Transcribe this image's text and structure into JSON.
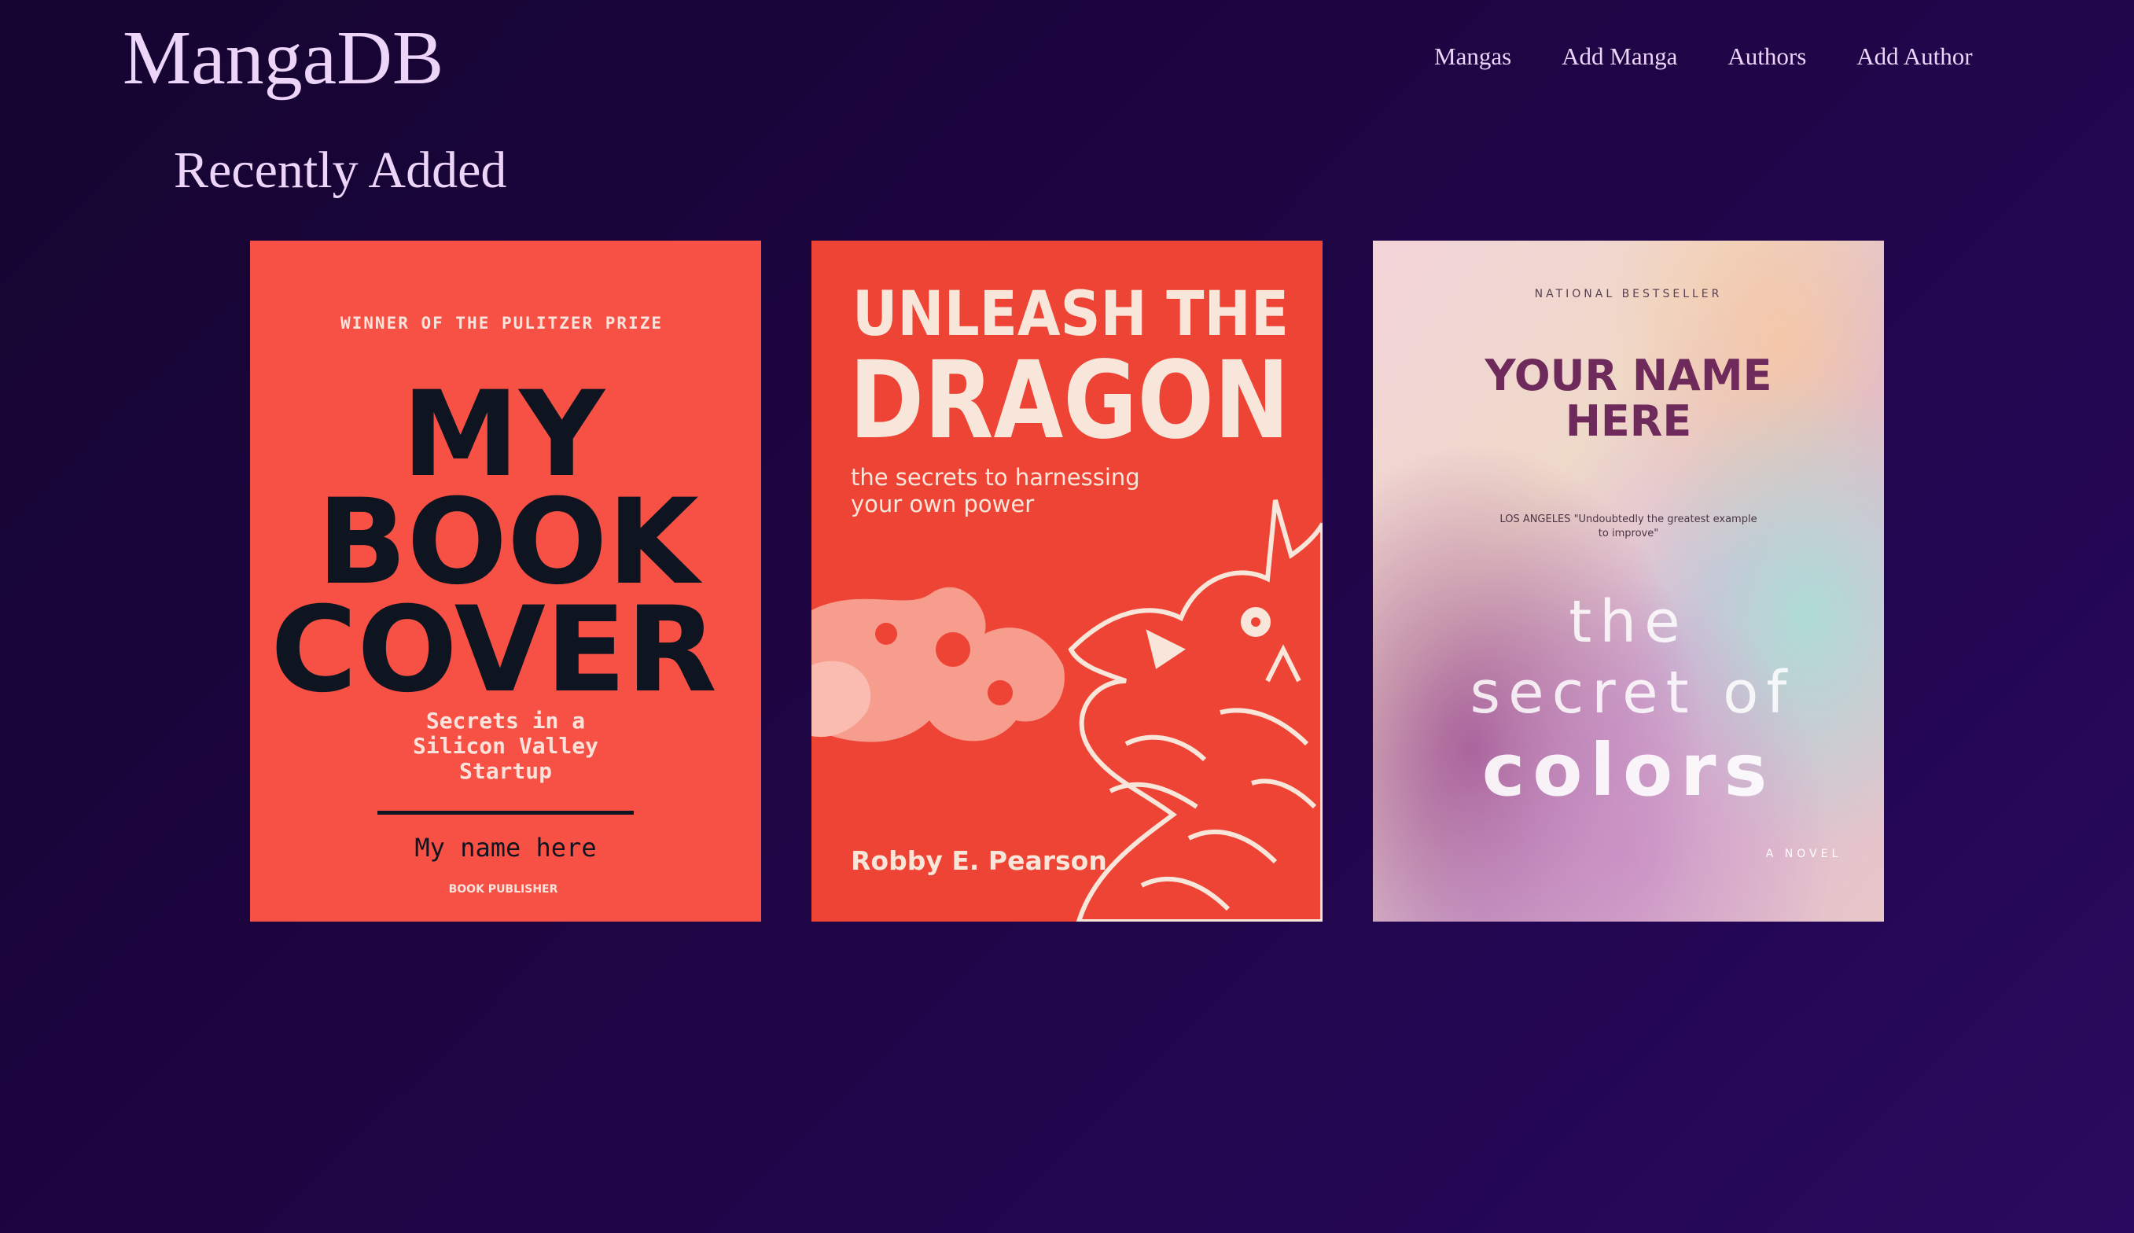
{
  "app": {
    "logo": "MangaDB"
  },
  "nav": {
    "items": [
      {
        "label": "Mangas"
      },
      {
        "label": "Add Manga"
      },
      {
        "label": "Authors"
      },
      {
        "label": "Add Author"
      }
    ]
  },
  "main": {
    "section_title": "Recently Added",
    "covers": [
      {
        "prize": "WINNER OF THE PULITZER PRIZE",
        "title_line1": "MY",
        "title_line2": "BOOK",
        "title_line3": "COVER",
        "subtitle_line1": "Secrets in a",
        "subtitle_line2": "Silicon Valley",
        "subtitle_line3": "Startup",
        "author": "My name here",
        "publisher": "BOOK PUBLISHER",
        "bg_color": "#f75146",
        "title_color": "#0f1520"
      },
      {
        "title_line1": "UNLEASH THE",
        "title_line2": "DRAGON",
        "subtitle_line1": "the secrets to harnessing",
        "subtitle_line2": "your own power",
        "author": "Robby E. Pearson",
        "bg_color": "#ee4435",
        "text_color": "#f8e6da"
      },
      {
        "kicker": "NATIONAL BESTSELLER",
        "author_line1": "YOUR NAME",
        "author_line2": "HERE",
        "quote_line1": "LOS ANGELES \"Undoubtedly the greatest example",
        "quote_line2": "to improve\"",
        "title_line1": "the",
        "title_line2": "secret of",
        "title_line3": "colors",
        "tag": "A NOVEL",
        "author_color": "#6e2a5a"
      }
    ]
  },
  "colors": {
    "background": "#1e0543",
    "text": "#ecd5f8"
  }
}
